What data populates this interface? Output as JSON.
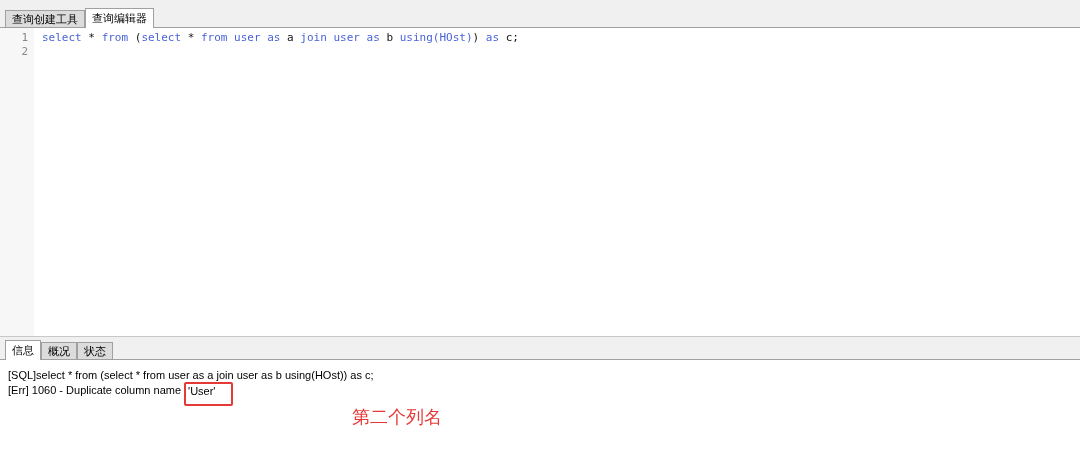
{
  "tabs": [
    {
      "label": "查询创建工具",
      "selected": false
    },
    {
      "label": "查询编辑器",
      "selected": true
    }
  ],
  "editor": {
    "lines": [
      {
        "number": "1",
        "tokens": [
          {
            "kind": "keyword",
            "text": "select"
          },
          {
            "kind": "plain",
            "text": " * "
          },
          {
            "kind": "keyword",
            "text": "from"
          },
          {
            "kind": "plain",
            "text": " ("
          },
          {
            "kind": "keyword",
            "text": "select"
          },
          {
            "kind": "plain",
            "text": " * "
          },
          {
            "kind": "keyword",
            "text": "from user as"
          },
          {
            "kind": "plain",
            "text": " a "
          },
          {
            "kind": "keyword",
            "text": "join user as"
          },
          {
            "kind": "plain",
            "text": " b "
          },
          {
            "kind": "keyword",
            "text": "using(HOst)"
          },
          {
            "kind": "plain",
            "text": ") "
          },
          {
            "kind": "keyword",
            "text": "as"
          },
          {
            "kind": "plain",
            "text": " c;"
          }
        ]
      },
      {
        "number": "2"
      }
    ]
  },
  "result_tabs": [
    {
      "label": "信息",
      "selected": true
    },
    {
      "label": "概况",
      "selected": false
    },
    {
      "label": "状态",
      "selected": false
    }
  ],
  "messages": {
    "sql": "[SQL]select * from (select * from user as a join user as b using(HOst)) as c;",
    "error": "[Err] 1060 - Duplicate column name",
    "highlighted": "'User'"
  },
  "annotation": "第二个列名"
}
